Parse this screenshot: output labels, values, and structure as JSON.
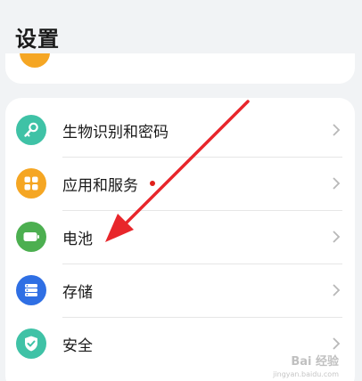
{
  "header": {
    "title": "设置"
  },
  "rows": [
    {
      "label": "生物识别和密码",
      "icon": "key-icon",
      "color": "#3fc2a6"
    },
    {
      "label": "应用和服务",
      "icon": "apps-grid-icon",
      "color": "#f5a623",
      "notification_dot": true
    },
    {
      "label": "电池",
      "icon": "battery-icon",
      "color": "#4caf50"
    },
    {
      "label": "存储",
      "icon": "storage-icon",
      "color": "#2f6fe4"
    },
    {
      "label": "安全",
      "icon": "shield-check-icon",
      "color": "#3fc2a6"
    }
  ],
  "colors": {
    "background": "#f1f3f5",
    "card": "#ffffff",
    "arrow": "#e8262b",
    "dot": "#e0201b"
  },
  "watermark": {
    "text": "Bai 经验",
    "sub": "jingyan.baidu.com"
  }
}
